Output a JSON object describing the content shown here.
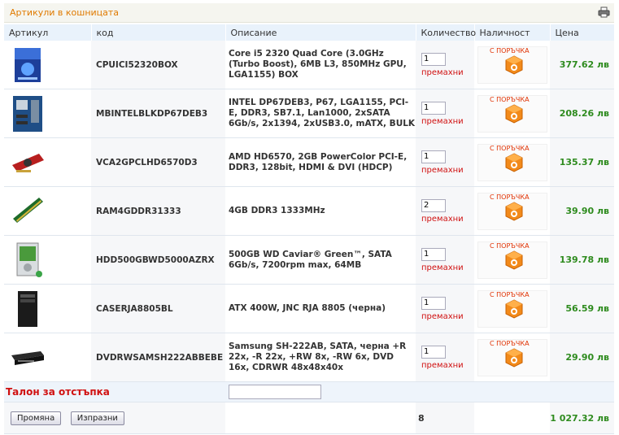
{
  "header": {
    "title": "Артикули в кошницата",
    "print_icon": "printer-icon"
  },
  "columns": [
    "Артикул",
    "код",
    "Описание",
    "Количество",
    "Наличност",
    "Цена"
  ],
  "items": [
    {
      "image": "cpu-box-image",
      "code": "CPUICI52320BOX",
      "description": "Core i5 2320 Quad Core (3.0GHz (Turbo Boost), 6MB L3, 850MHz GPU, LGA1155) BOX",
      "qty": "1",
      "remove": "премахни",
      "availability": "С ПОРЪЧКА",
      "price": "377.62 лв"
    },
    {
      "image": "motherboard-image",
      "code": "MBINTELBLKDP67DEB3",
      "description": "INTEL DP67DEB3, P67, LGA1155, PCI-E, DDR3, SB7.1, Lan1000, 2xSATA 6Gb/s, 2x1394, 2xUSB3.0, mATX, BULK",
      "qty": "1",
      "remove": "премахни",
      "availability": "С ПОРЪЧКА",
      "price": "208.26 лв"
    },
    {
      "image": "graphics-card-image",
      "code": "VCA2GPCLHD6570D3",
      "description": "AMD HD6570, 2GB PowerColor PCI-E, DDR3, 128bit, HDMI & DVI (HDCP)",
      "qty": "1",
      "remove": "премахни",
      "availability": "С ПОРЪЧКА",
      "price": "135.37 лв"
    },
    {
      "image": "ram-module-image",
      "code": "RAM4GDDR31333",
      "description": "4GB DDR3 1333MHz",
      "qty": "2",
      "remove": "премахни",
      "availability": "С ПОРЪЧКА",
      "price": "39.90 лв"
    },
    {
      "image": "hard-drive-image",
      "code": "HDD500GBWD5000AZRX",
      "description": "500GB WD Caviar® Green™, SATA 6Gb/s, 7200rpm max, 64MB",
      "qty": "1",
      "remove": "премахни",
      "availability": "С ПОРЪЧКА",
      "price": "139.78 лв"
    },
    {
      "image": "pc-case-image",
      "code": "CASERJA8805BL",
      "description": "ATX 400W, JNC RJA 8805 (черна)",
      "qty": "1",
      "remove": "премахни",
      "availability": "С ПОРЪЧКА",
      "price": "56.59 лв"
    },
    {
      "image": "dvd-drive-image",
      "code": "DVDRWSAMSH222ABBEBE",
      "description": "Samsung SH-222AB, SATA, черна +R 22x, -R 22x, +RW 8x, -RW 6x, DVD 16x, CDRWR 48x48x40x",
      "qty": "1",
      "remove": "премахни",
      "availability": "С ПОРЪЧКА",
      "price": "29.90 лв"
    }
  ],
  "coupon": {
    "label": "Талон за отстъпка",
    "value": ""
  },
  "footer": {
    "update_label": "Промяна",
    "clear_label": "Изпразни",
    "total_qty": "8",
    "total_price": "1 027.32 лв"
  },
  "colors": {
    "accent": "#e07a00",
    "price": "#2e8b1e",
    "remove": "#d01010",
    "header_bg": "#e9f2fb"
  }
}
